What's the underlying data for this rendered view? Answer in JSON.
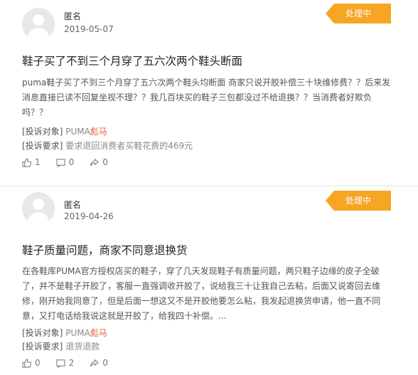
{
  "complaints": [
    {
      "user": "匿名",
      "date": "2019-05-07",
      "status": "处理中",
      "title": "鞋子买了不到三个月穿了五六次两个鞋头断面",
      "description": "puma鞋子买了不到三个月穿了五六次两个鞋头均断面 商家只说开胶补偿三十块维修费？？后来发消息直接已读不回复坐视不理？？我几百块买的鞋子三包都没过不给退换？？当消费者好欺负吗？？",
      "target_label": "[投诉对象]",
      "target_brand": "PUMA",
      "target_suffix": "彪马",
      "request_label": "[投诉要求]",
      "request": "要求退回消费者买鞋花费的469元",
      "likes": "1",
      "comments": "0",
      "shares": "0"
    },
    {
      "user": "匿名",
      "date": "2019-04-26",
      "status": "处理中",
      "title": "鞋子质量问题，商家不同意退换货",
      "description": "在各鞋库PUMA官方授权店买的鞋子，穿了几天发现鞋子有质量问题，两只鞋子边缘的皮子全破了，并不是鞋子开胶了，客服一直强调收开胶了，说给我三十让我自己去粘，后面又说寄回去维修，刚开始我同意了，但是后面一想这又不是开胶他要怎么粘，我发起退换货申请，他一直不同意，又打电话给我说这就是开胶了，给我四十补偿。...",
      "target_label": "[投诉对象]",
      "target_brand": "PUMA",
      "target_suffix": "彪马",
      "request_label": "[投诉要求]",
      "request": "退货退款",
      "likes": "0",
      "comments": "2",
      "shares": "0"
    }
  ],
  "icons": {
    "avatar": "default-user-avatar",
    "like": "thumbs-up-icon",
    "comment": "comment-icon",
    "share": "share-icon"
  },
  "colors": {
    "status_badge": "#f6a623",
    "brand_highlight": "#e6592b"
  }
}
